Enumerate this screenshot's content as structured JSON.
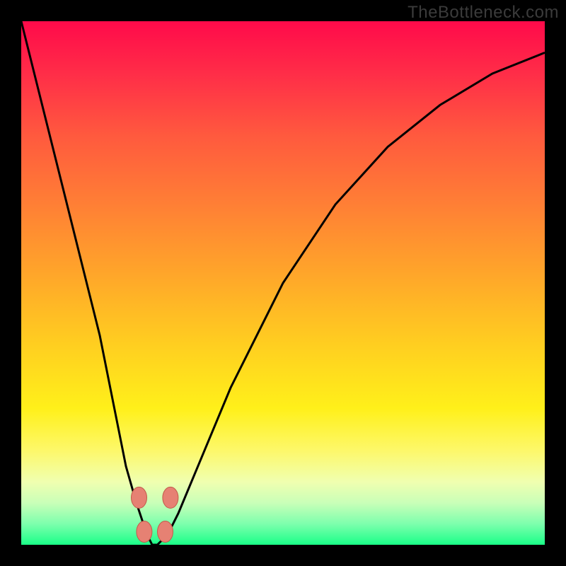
{
  "watermark": {
    "text": "TheBottleneck.com"
  },
  "colors": {
    "background": "#000000",
    "curve": "#000000",
    "bead_fill": "#e68173",
    "bead_stroke": "#c25a4a",
    "gradient_stops": [
      "#ff0a4a",
      "#ff2d48",
      "#ff5a3e",
      "#ff7f35",
      "#ffa52a",
      "#ffcf20",
      "#fff01a",
      "#fdf86a",
      "#f0ffb0",
      "#c9ffb8",
      "#7dffad",
      "#1aff88"
    ]
  },
  "chart_data": {
    "type": "line",
    "title": "",
    "xlabel": "",
    "ylabel": "",
    "xlim": [
      0,
      100
    ],
    "ylim": [
      0,
      100
    ],
    "note": "Single V-shaped curve; minimum near x≈25. Left branch steep, right branch shallower. Y normalized to 0–100 (top=100, bottom=0). Values estimated from pixels; no axis ticks shown.",
    "series": [
      {
        "name": "bottleneck-curve",
        "x": [
          0,
          5,
          10,
          15,
          18,
          20,
          22,
          24,
          25,
          26,
          28,
          30,
          35,
          40,
          50,
          60,
          70,
          80,
          90,
          100
        ],
        "values": [
          100,
          80,
          60,
          40,
          25,
          15,
          8,
          2,
          0,
          0,
          2,
          6,
          18,
          30,
          50,
          65,
          76,
          84,
          90,
          94
        ]
      }
    ],
    "markers": [
      {
        "name": "bead-left-upper",
        "x": 22.5,
        "y": 9
      },
      {
        "name": "bead-left-lower",
        "x": 23.5,
        "y": 2.5
      },
      {
        "name": "bead-right-lower",
        "x": 27.5,
        "y": 2.5
      },
      {
        "name": "bead-right-upper",
        "x": 28.5,
        "y": 9
      }
    ]
  }
}
